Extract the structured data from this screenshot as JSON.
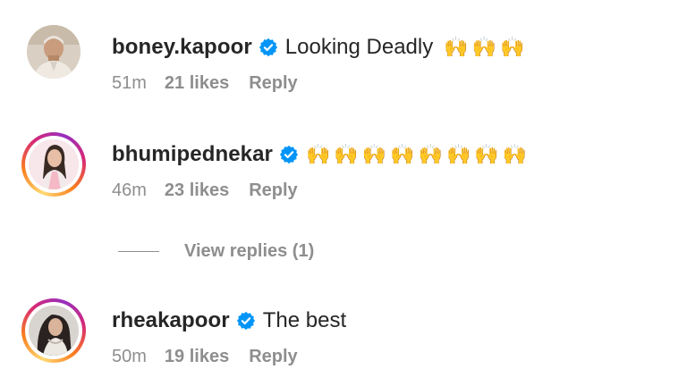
{
  "colors": {
    "verified_blue": "#0095f6",
    "meta_gray": "#8e8e8e",
    "text_dark": "#262626"
  },
  "comments": [
    {
      "username": "boney.kapoor",
      "verified": true,
      "text": "Looking Deadly",
      "emojis": "🙌🙌🙌",
      "time": "51m",
      "likes": "21 likes",
      "reply": "Reply",
      "avatar_icon": "avatar"
    },
    {
      "username": "bhumipednekar",
      "verified": true,
      "text": "",
      "emojis": "🙌🙌🙌🙌🙌🙌🙌🙌",
      "time": "46m",
      "likes": "23 likes",
      "reply": "Reply",
      "avatar_icon": "avatar-story-ring"
    },
    {
      "username": "rheakapoor",
      "verified": true,
      "text": "The best",
      "emojis": "",
      "time": "50m",
      "likes": "19 likes",
      "reply": "Reply",
      "avatar_icon": "avatar-story-ring"
    }
  ],
  "view_replies": "View replies (1)"
}
